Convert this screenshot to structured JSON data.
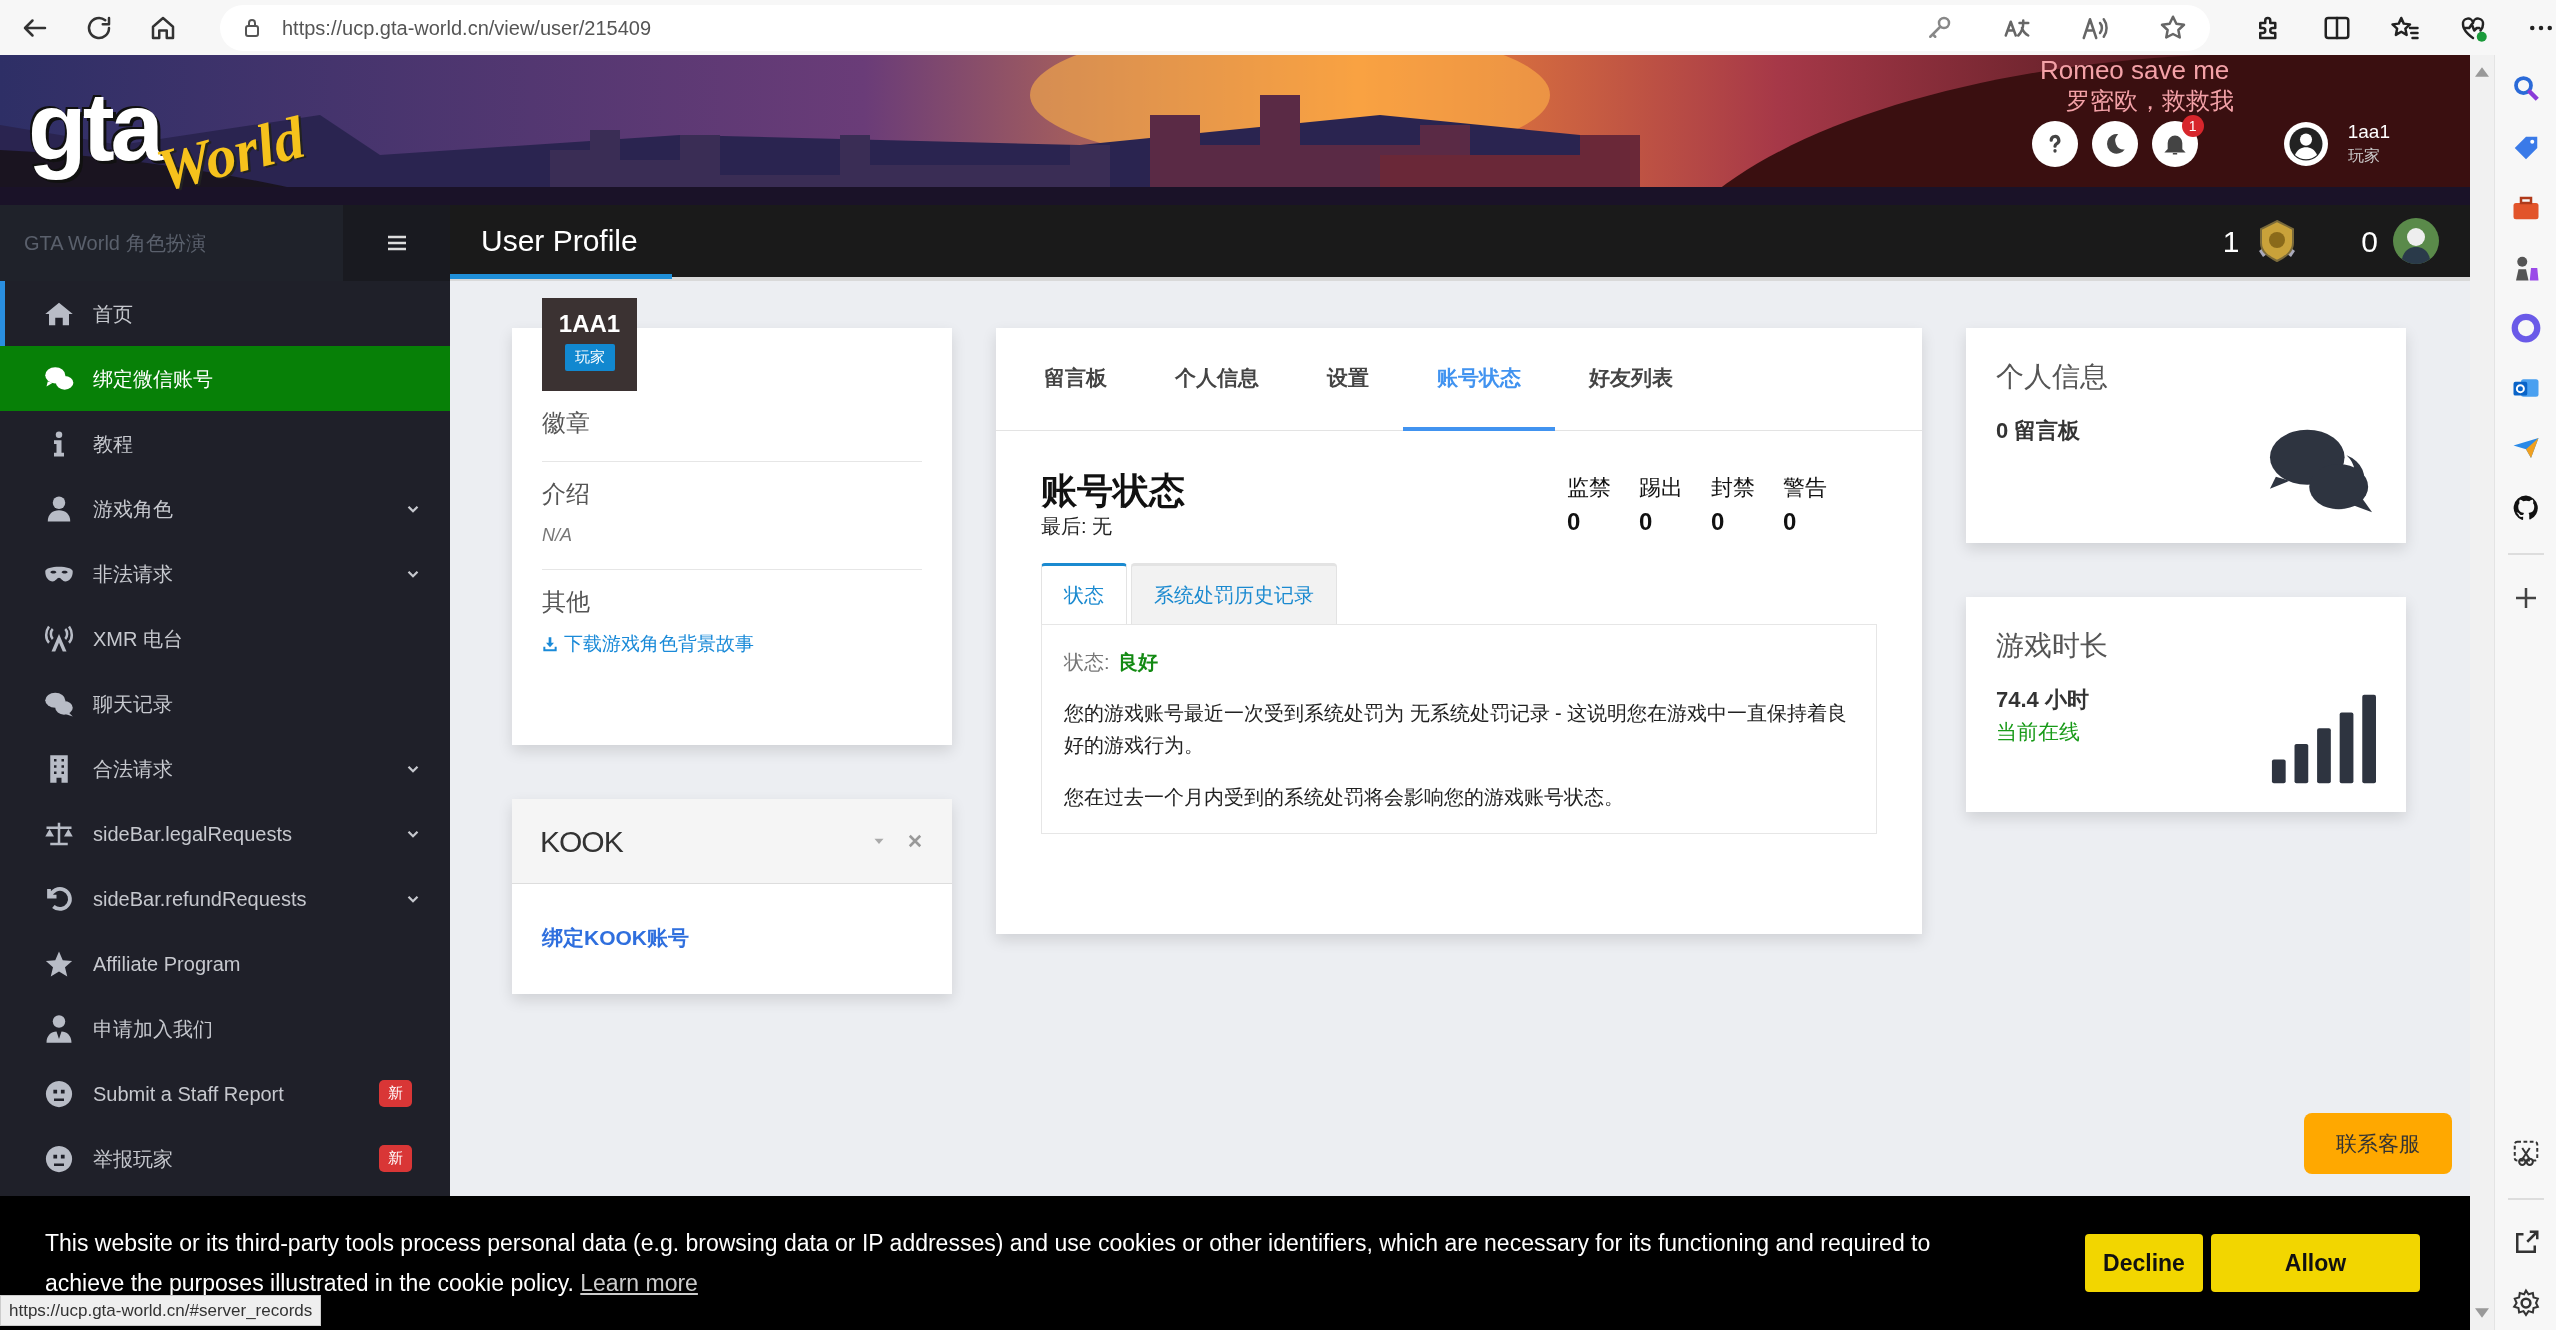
{
  "browser": {
    "url": "https://ucp.gta-world.cn/view/user/215409",
    "status_url": "https://ucp.gta-world.cn/#server_records"
  },
  "overlay_texts": [
    "Romeo save me",
    "罗密欧，救救我"
  ],
  "header": {
    "logo": {
      "main": "gta",
      "script": "World"
    },
    "notification_count": "1",
    "user": {
      "name": "1aa1",
      "role": "玩家"
    }
  },
  "sidebar": {
    "brand": "GTA World 角色扮演",
    "items": [
      {
        "label": "首页",
        "selected": true,
        "highlighted": false,
        "expandable": false
      },
      {
        "label": "绑定微信账号",
        "selected": false,
        "highlighted": true,
        "expandable": false
      },
      {
        "label": "教程",
        "selected": false,
        "highlighted": false,
        "expandable": false
      },
      {
        "label": "游戏角色",
        "selected": false,
        "highlighted": false,
        "expandable": true
      },
      {
        "label": "非法请求",
        "selected": false,
        "highlighted": false,
        "expandable": true
      },
      {
        "label": "XMR 电台",
        "selected": false,
        "highlighted": false,
        "expandable": false
      },
      {
        "label": "聊天记录",
        "selected": false,
        "highlighted": false,
        "expandable": false
      },
      {
        "label": "合法请求",
        "selected": false,
        "highlighted": false,
        "expandable": true
      },
      {
        "label": "sideBar.legalRequests",
        "selected": false,
        "highlighted": false,
        "expandable": true
      },
      {
        "label": "sideBar.refundRequests",
        "selected": false,
        "highlighted": false,
        "expandable": true
      },
      {
        "label": "Affiliate Program",
        "selected": false,
        "highlighted": false,
        "expandable": false
      },
      {
        "label": "申请加入我们",
        "selected": false,
        "highlighted": false,
        "expandable": false
      },
      {
        "label": "Submit a Staff Report",
        "selected": false,
        "highlighted": false,
        "expandable": false,
        "badge": "新"
      },
      {
        "label": "举报玩家",
        "selected": false,
        "highlighted": false,
        "expandable": false,
        "badge": "新"
      }
    ]
  },
  "topbar": {
    "title": "User Profile",
    "counters": [
      {
        "kind": "medal",
        "value": "1"
      },
      {
        "kind": "avatar",
        "value": "0"
      }
    ]
  },
  "profile": {
    "name": "1AA1",
    "role": "玩家",
    "sections": [
      {
        "heading": "徽章"
      },
      {
        "heading": "介绍",
        "text": "N/A"
      },
      {
        "heading": "其他",
        "link": "下载游戏角色背景故事"
      }
    ]
  },
  "kook": {
    "title": "KOOK",
    "link": "绑定KOOK账号"
  },
  "account": {
    "tabs": [
      {
        "label": "留言板",
        "selected": false
      },
      {
        "label": "个人信息",
        "selected": false
      },
      {
        "label": "设置",
        "selected": false
      },
      {
        "label": "账号状态",
        "selected": true
      },
      {
        "label": "好友列表",
        "selected": false
      }
    ],
    "title": "账号状态",
    "last": "最后: 无",
    "counters": [
      {
        "label": "监禁",
        "value": "0"
      },
      {
        "label": "踢出",
        "value": "0"
      },
      {
        "label": "封禁",
        "value": "0"
      },
      {
        "label": "警告",
        "value": "0"
      }
    ],
    "subtabs": [
      {
        "label": "状态",
        "selected": true
      },
      {
        "label": "系统处罚历史记录",
        "selected": false
      }
    ],
    "status_label": "状态:",
    "status_value": "良好",
    "paragraphs": [
      "您的游戏账号最近一次受到系统处罚为 无系统处罚记录 - 这说明您在游戏中一直保持着良好的游戏行为。",
      "您在过去一个月内受到的系统处罚将会影响您的游戏账号状态。"
    ]
  },
  "info_cards": [
    {
      "kind": "messages",
      "title": "个人信息",
      "value": "0 留言板"
    },
    {
      "kind": "playtime",
      "title": "游戏时长",
      "value": "74.4 小时",
      "status": "当前在线"
    }
  ],
  "contact_button": "联系客服",
  "cookie": {
    "text": "This website or its third-party tools process personal data (e.g. browsing data or IP addresses) and use cookies or other identifiers, which are necessary for its functioning and required to achieve the purposes illustrated in the cookie policy.",
    "link": "Learn more",
    "buttons": [
      "Decline",
      "Allow"
    ]
  }
}
